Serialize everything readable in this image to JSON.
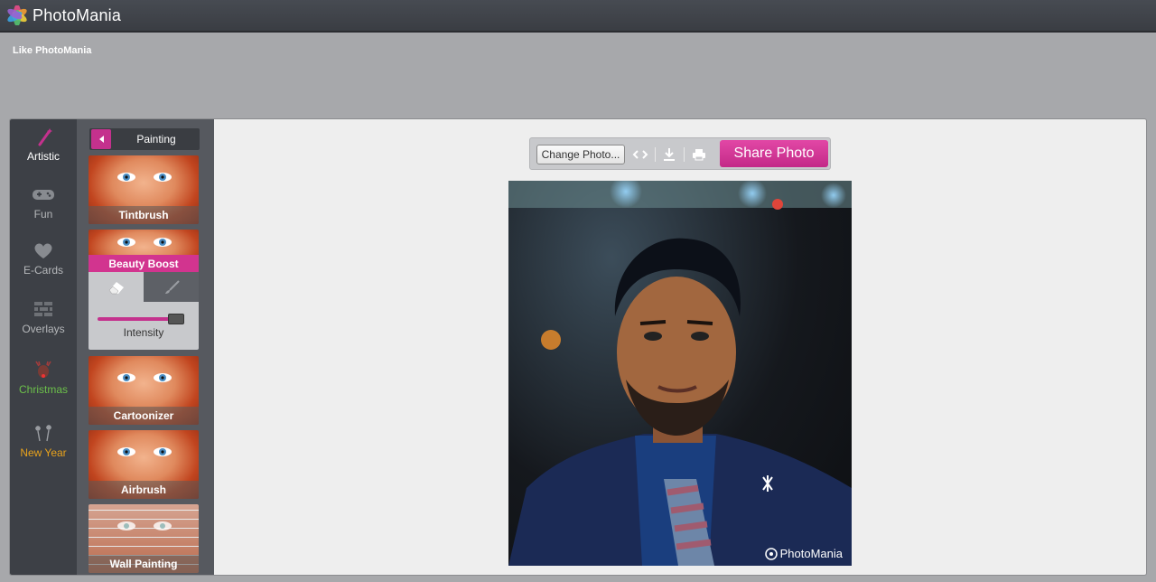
{
  "app": {
    "name": "PhotoMania"
  },
  "like_text": "Like PhotoMania",
  "categories": [
    {
      "label": "Artistic",
      "icon": "magic-wand-icon",
      "color": "#ffffff"
    },
    {
      "label": "Fun",
      "icon": "gamepad-icon",
      "color": "#b5b7ba"
    },
    {
      "label": "E-Cards",
      "icon": "heart-icon",
      "color": "#b5b7ba"
    },
    {
      "label": "Overlays",
      "icon": "brick-wall-icon",
      "color": "#b5b7ba"
    },
    {
      "label": "Christmas",
      "icon": "reindeer-icon",
      "color": "#6cc04a"
    },
    {
      "label": "New Year",
      "icon": "fireworks-icon",
      "color": "#e8a21c"
    }
  ],
  "effects_panel": {
    "title": "Painting",
    "effects": [
      {
        "label": "Tintbrush"
      },
      {
        "label": "Beauty Boost",
        "active": true
      },
      {
        "label": "Cartoonizer"
      },
      {
        "label": "Airbrush"
      },
      {
        "label": "Wall Painting"
      }
    ],
    "options": {
      "tabs": [
        "eraser-icon",
        "brush-icon"
      ],
      "intensity_label": "Intensity",
      "intensity_fraction": 0.95
    }
  },
  "toolbar": {
    "change_photo": "Change Photo...",
    "compare_icon": "compare-arrows-icon",
    "download_icon": "download-icon",
    "print_icon": "print-icon",
    "share": "Share Photo"
  },
  "photo": {
    "watermark": "PhotoMania"
  },
  "colors": {
    "accent": "#c4318d",
    "topbar": "#3f4248",
    "sidebar": "#3d4046"
  }
}
